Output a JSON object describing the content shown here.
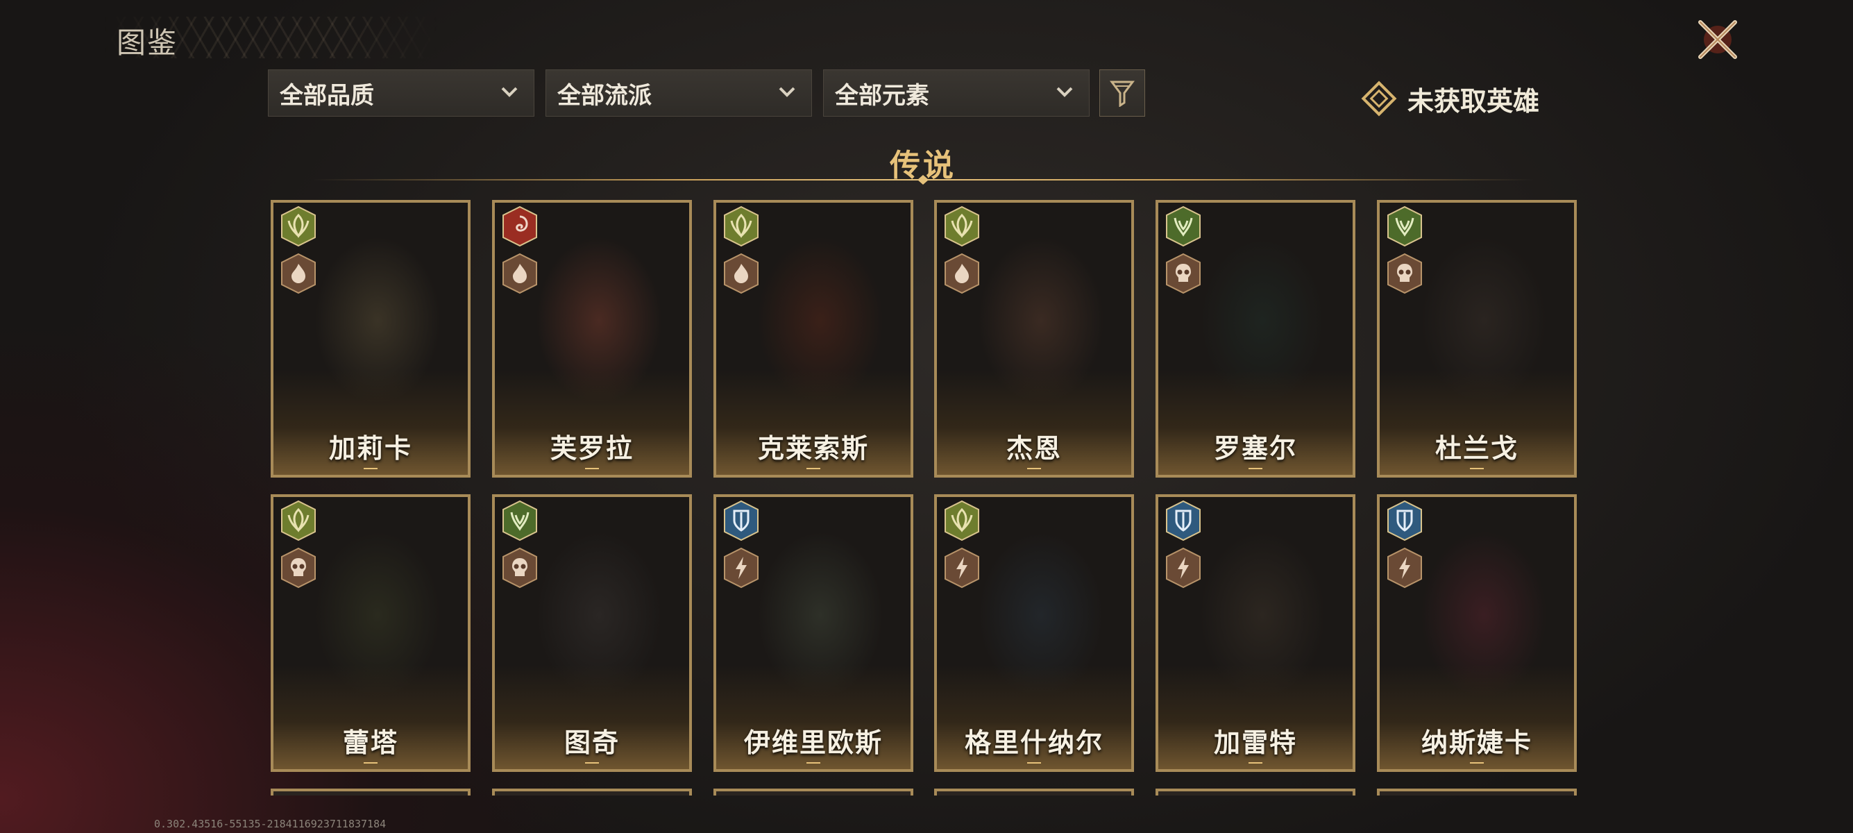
{
  "header": {
    "title": "图鉴",
    "close_icon": "close-x-icon"
  },
  "filters": {
    "quality": "全部品质",
    "school": "全部流派",
    "element": "全部元素",
    "filter_icon": "funnel-icon",
    "unowned_label": "未获取英雄"
  },
  "section": {
    "title": "传说"
  },
  "heroes": [
    {
      "name": "加莉卡",
      "class_icon": "leaf-emblem-icon",
      "class_color": "#6e7d2e",
      "element_icon": "flame-icon"
    },
    {
      "name": "芙罗拉",
      "class_icon": "swirl-emblem-icon",
      "class_color": "#9a2d22",
      "element_icon": "flame-icon"
    },
    {
      "name": "克莱索斯",
      "class_icon": "leaf-emblem-icon",
      "class_color": "#6e7d2e",
      "element_icon": "flame-icon"
    },
    {
      "name": "杰恩",
      "class_icon": "leaf-emblem-icon",
      "class_color": "#6e7d2e",
      "element_icon": "flame-icon"
    },
    {
      "name": "罗塞尔",
      "class_icon": "horn-emblem-icon",
      "class_color": "#4d6b2a",
      "element_icon": "skull-icon"
    },
    {
      "name": "杜兰戈",
      "class_icon": "horn-emblem-icon",
      "class_color": "#4d6b2a",
      "element_icon": "skull-icon"
    },
    {
      "name": "蕾塔",
      "class_icon": "leaf-emblem-icon",
      "class_color": "#6e7d2e",
      "element_icon": "skull-icon"
    },
    {
      "name": "图奇",
      "class_icon": "horn-emblem-icon",
      "class_color": "#4d6b2a",
      "element_icon": "skull-icon"
    },
    {
      "name": "伊维里欧斯",
      "class_icon": "shield-emblem-icon",
      "class_color": "#2f5a7e",
      "element_icon": "lightning-icon"
    },
    {
      "name": "格里什纳尔",
      "class_icon": "leaf-emblem-icon",
      "class_color": "#6e7d2e",
      "element_icon": "lightning-icon"
    },
    {
      "name": "加雷特",
      "class_icon": "shield-emblem-icon",
      "class_color": "#2f5a7e",
      "element_icon": "lightning-icon"
    },
    {
      "name": "纳斯婕卡",
      "class_icon": "shield-emblem-icon",
      "class_color": "#2f5a7e",
      "element_icon": "lightning-icon"
    }
  ],
  "footer": {
    "version": "0.302.43516-55135-21841169237118371​84"
  }
}
